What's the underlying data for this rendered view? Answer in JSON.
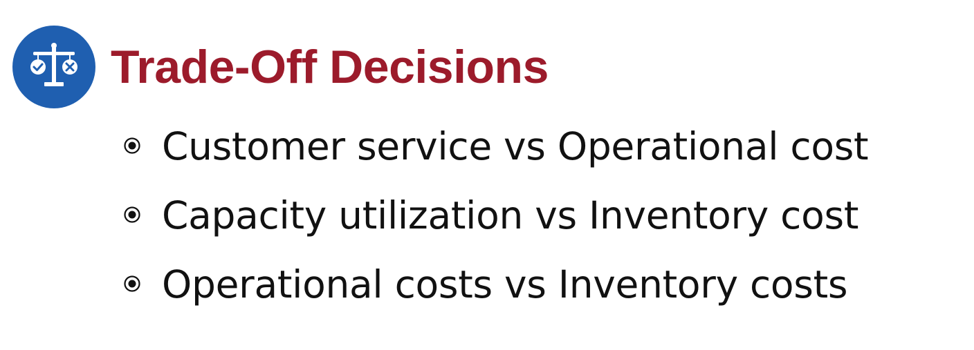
{
  "slide": {
    "icon": "balance-scale-icon",
    "accent_color": "#1f5fb0",
    "title_color": "#9c1b2b",
    "title": "Trade-Off Decisions",
    "bullet_icon": "radio-bullet-icon",
    "bullets": [
      {
        "text": "Customer service vs Operational cost"
      },
      {
        "text": "Capacity utilization vs Inventory cost"
      },
      {
        "text": "Operational costs vs Inventory costs"
      }
    ]
  }
}
